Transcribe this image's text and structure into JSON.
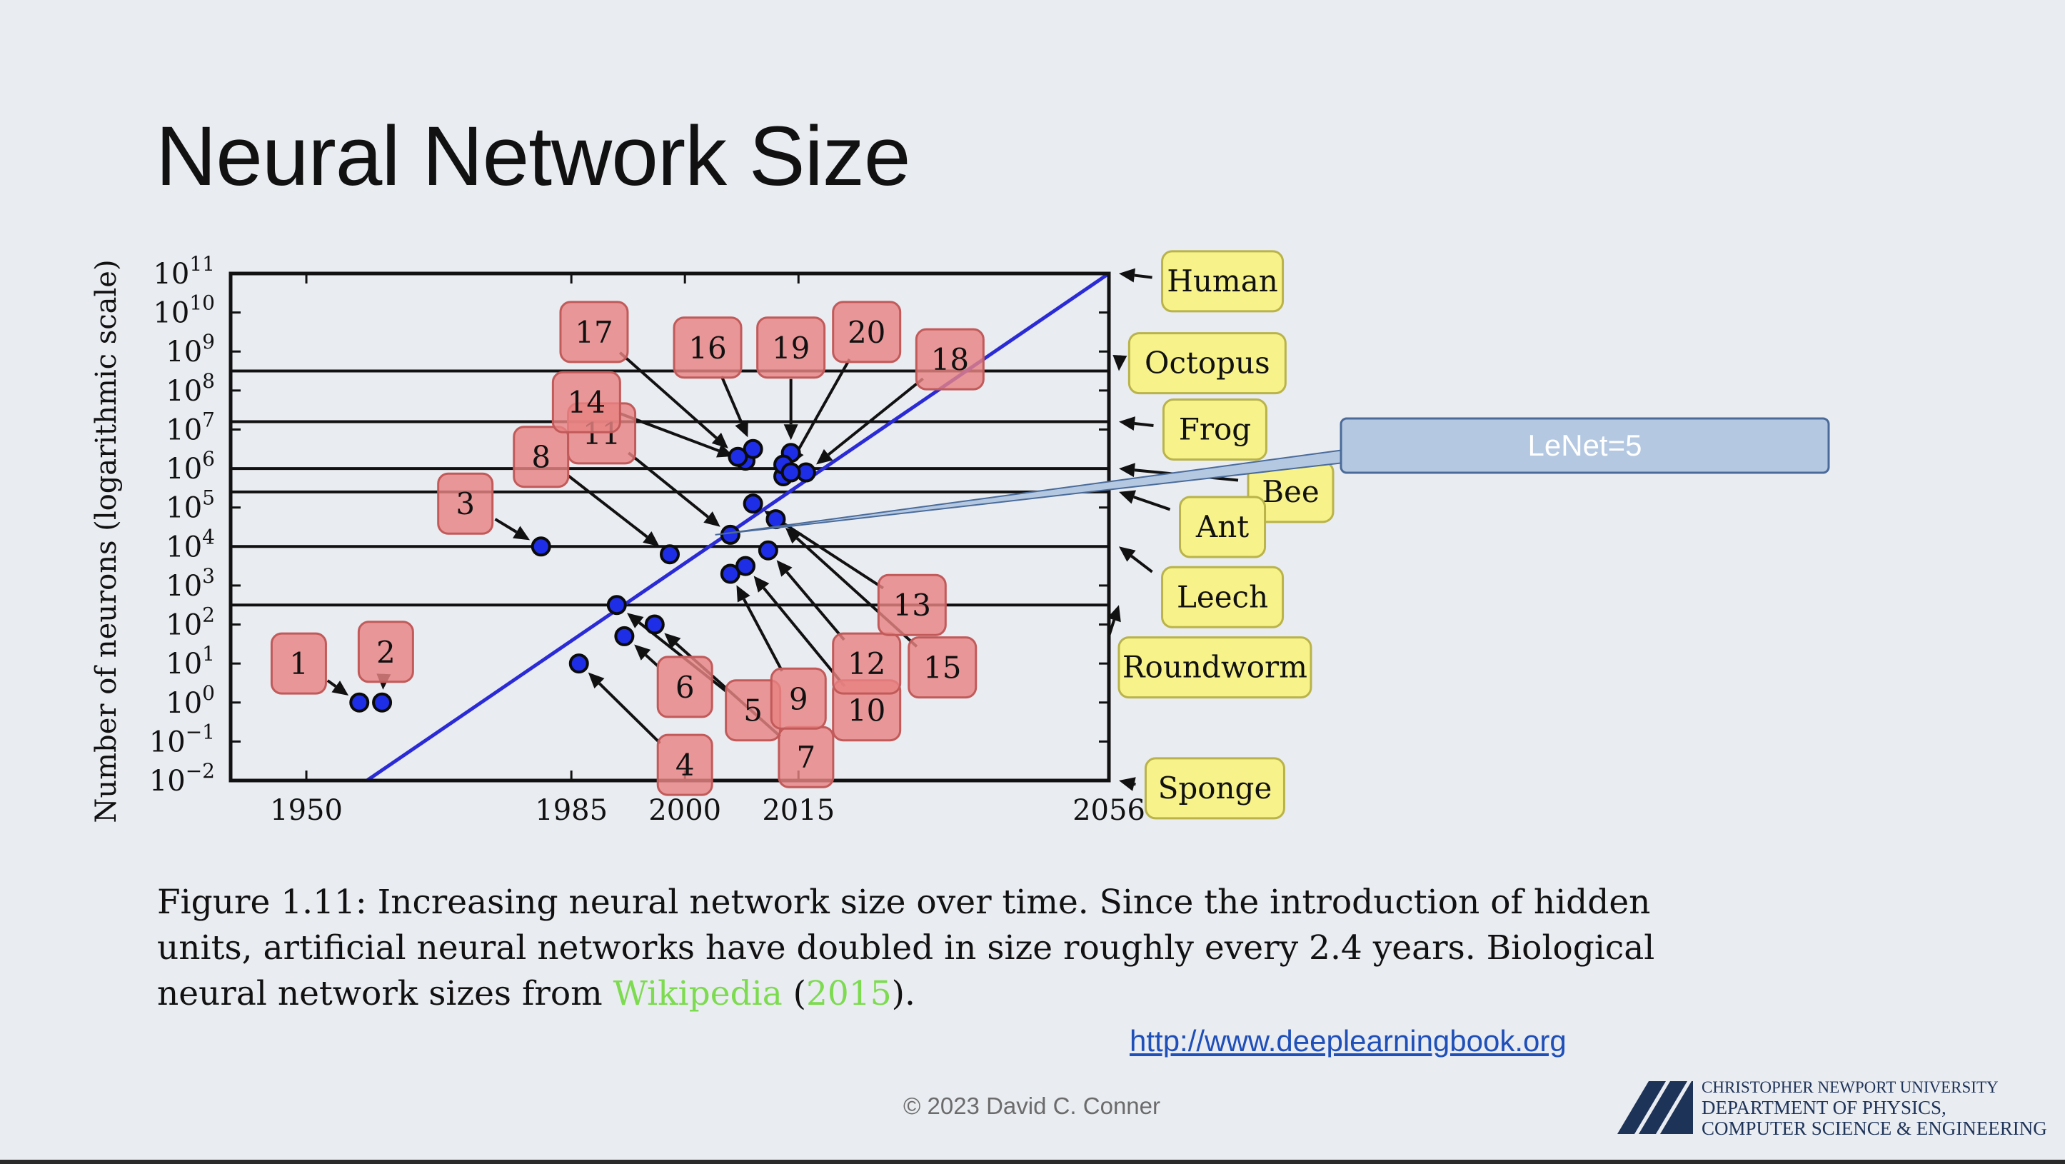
{
  "slide": {
    "title": "Neural Network Size",
    "caption_prefix": "Figure 1.11: Increasing neural network size over time. Since the introduction of hidden units, artificial neural networks have doubled in size roughly every 2.4 years. Biological neural network sizes from ",
    "caption_link": "Wikipedia",
    "caption_paren_open": " (",
    "caption_year": "2015",
    "caption_suffix": ").",
    "source_link": "http://www.deeplearningbook.org",
    "copyright": "© 2023 David C. Conner",
    "logo": {
      "line1": "CHRISTOPHER NEWPORT UNIVERSITY",
      "line2": "DEPARTMENT OF PHYSICS,",
      "line3": "COMPUTER SCIENCE & ENGINEERING"
    },
    "colors": {
      "background": "#e9ecf1",
      "trend": "#2b2bd6",
      "point": "#1e2ee6",
      "network_box": "#e88282",
      "animal_box": "#f7f28a",
      "callout": "#b4c8e2"
    }
  },
  "chart_data": {
    "type": "scatter",
    "xlabel": "",
    "ylabel": "Number of neurons (logarithmic scale)",
    "yscale": "log",
    "xlim": [
      1940,
      2056
    ],
    "ylim": [
      -2,
      11
    ],
    "x_ticks": [
      1950,
      1985,
      2000,
      2015,
      2056
    ],
    "y_ticks": [
      -2,
      -1,
      0,
      1,
      2,
      3,
      4,
      5,
      6,
      7,
      8,
      9,
      10,
      11
    ],
    "y_tick_labels": [
      {
        "base": "10",
        "exp": "−2"
      },
      {
        "base": "10",
        "exp": "−1"
      },
      {
        "base": "10",
        "exp": "0"
      },
      {
        "base": "10",
        "exp": "1"
      },
      {
        "base": "10",
        "exp": "2"
      },
      {
        "base": "10",
        "exp": "3"
      },
      {
        "base": "10",
        "exp": "4"
      },
      {
        "base": "10",
        "exp": "5"
      },
      {
        "base": "10",
        "exp": "6"
      },
      {
        "base": "10",
        "exp": "7"
      },
      {
        "base": "10",
        "exp": "8"
      },
      {
        "base": "10",
        "exp": "9"
      },
      {
        "base": "10",
        "exp": "10"
      },
      {
        "base": "10",
        "exp": "11"
      }
    ],
    "trend_line": {
      "x": [
        1958,
        2056
      ],
      "y": [
        -2,
        11
      ]
    },
    "reference_lines": [
      {
        "name": "Human",
        "y": 11
      },
      {
        "name": "Octopus",
        "y": 8.5
      },
      {
        "name": "Frog",
        "y": 7.2
      },
      {
        "name": "Bee",
        "y": 6
      },
      {
        "name": "Ant",
        "y": 5.4
      },
      {
        "name": "Leech",
        "y": 4
      },
      {
        "name": "Roundworm",
        "y": 2.5
      },
      {
        "name": "Sponge",
        "y": -2
      }
    ],
    "animal_labels": [
      {
        "name": "Human",
        "x": 2071,
        "y": 10.8
      },
      {
        "name": "Octopus",
        "x": 2069,
        "y": 8.7
      },
      {
        "name": "Frog",
        "x": 2070,
        "y": 7.0
      },
      {
        "name": "Bee",
        "x": 2080,
        "y": 5.4
      },
      {
        "name": "Ant",
        "x": 2071,
        "y": 4.5
      },
      {
        "name": "Leech",
        "x": 2071,
        "y": 2.7
      },
      {
        "name": "Roundworm",
        "x": 2070,
        "y": 0.9
      },
      {
        "name": "Sponge",
        "x": 2070,
        "y": -2.2
      }
    ],
    "networks": [
      {
        "label": "1",
        "x": 1957,
        "y": 0,
        "lx": 1949,
        "ly": 1
      },
      {
        "label": "2",
        "x": 1960,
        "y": 0,
        "lx": 1960.5,
        "ly": 1.3
      },
      {
        "label": "3",
        "x": 1981,
        "y": 4,
        "lx": 1971,
        "ly": 5.1
      },
      {
        "label": "4",
        "x": 1986,
        "y": 1,
        "lx": 2000,
        "ly": -1.6
      },
      {
        "label": "5",
        "x": 1991,
        "y": 2.5,
        "lx": 2009,
        "ly": -0.2
      },
      {
        "label": "6",
        "x": 1992,
        "y": 1.7,
        "lx": 2000,
        "ly": 0.4
      },
      {
        "label": "7",
        "x": 1996,
        "y": 2,
        "lx": 2016,
        "ly": -1.4
      },
      {
        "label": "8",
        "x": 1998,
        "y": 3.8,
        "lx": 1981,
        "ly": 6.3
      },
      {
        "label": "9",
        "x": 2006,
        "y": 3.3,
        "lx": 2015,
        "ly": 0.1
      },
      {
        "label": "10",
        "x": 2008,
        "y": 3.5,
        "lx": 2024,
        "ly": -0.2
      },
      {
        "label": "11",
        "x": 2006,
        "y": 4.3,
        "lx": 1989,
        "ly": 6.9
      },
      {
        "label": "12",
        "x": 2011,
        "y": 3.9,
        "lx": 2024,
        "ly": 1
      },
      {
        "label": "13",
        "x": 2009,
        "y": 5.1,
        "lx": 2030,
        "ly": 2.5
      },
      {
        "label": "14",
        "x": 2008,
        "y": 6.2,
        "lx": 1987,
        "ly": 7.7
      },
      {
        "label": "15",
        "x": 2012,
        "y": 4.7,
        "lx": 2034,
        "ly": 0.9
      },
      {
        "label": "16",
        "x": 2009,
        "y": 6.5,
        "lx": 2003,
        "ly": 9.1
      },
      {
        "label": "17",
        "x": 2007,
        "y": 6.3,
        "lx": 1988,
        "ly": 9.5
      },
      {
        "label": "18",
        "x": 2016,
        "y": 5.9,
        "lx": 2035,
        "ly": 8.8
      },
      {
        "label": "19",
        "x": 2014,
        "y": 6.4,
        "lx": 2014,
        "ly": 9.1
      },
      {
        "label": "20",
        "x": 2013,
        "y": 5.8,
        "lx": 2024,
        "ly": 9.5
      }
    ],
    "extra_points": [
      {
        "x": 2013,
        "y": 6.1
      },
      {
        "x": 2014,
        "y": 5.9
      }
    ],
    "callout": {
      "text": "LeNet=5",
      "x": 2004,
      "y": 4.3
    }
  }
}
